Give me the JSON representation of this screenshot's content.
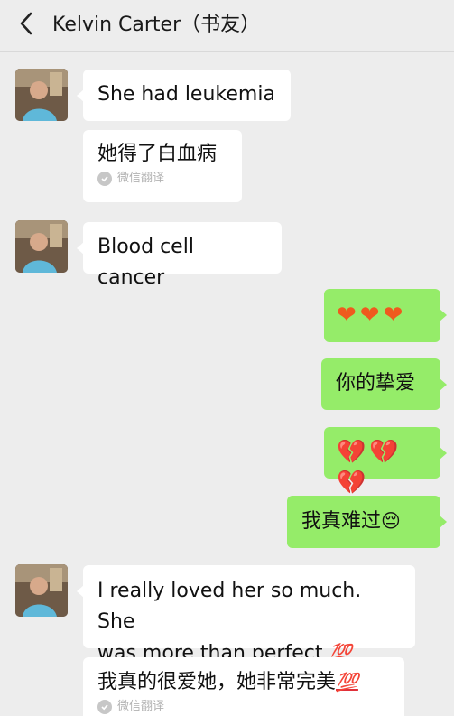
{
  "header": {
    "title": "Kelvin Carter（书友）"
  },
  "messages": {
    "m1": {
      "text": "She had leukemia"
    },
    "m2": {
      "text": "她得了白血病",
      "tag": "微信翻译"
    },
    "m3": {
      "text": "Blood cell cancer"
    },
    "m4": {
      "text": "❤❤❤"
    },
    "m5": {
      "text": "你的挚爱"
    },
    "m6": {
      "text": "💔💔💔"
    },
    "m7": {
      "text": "我真难过",
      "emoji": "😔"
    },
    "m8": {
      "text": "I really loved her so much. She\nwas more than perfect",
      "emoji": "💯"
    },
    "m9": {
      "text": "我真的很爱她，她非常完美",
      "emoji": "💯",
      "tag": "微信翻译"
    }
  },
  "icons": {
    "back": "chevron-left-icon",
    "translate_check": "check-circle-icon"
  },
  "colors": {
    "background": "#ededed",
    "incoming_bubble": "#ffffff",
    "outgoing_bubble": "#95ec69",
    "heart": "#ef5a1e"
  }
}
